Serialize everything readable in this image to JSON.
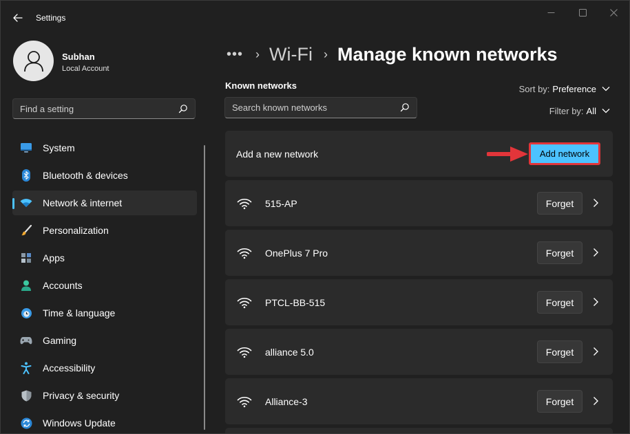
{
  "window": {
    "title": "Settings"
  },
  "user": {
    "name": "Subhan",
    "account_type": "Local Account"
  },
  "sidebar": {
    "search_placeholder": "Find a setting",
    "items": [
      {
        "label": "System",
        "icon": "monitor-icon",
        "active": false
      },
      {
        "label": "Bluetooth & devices",
        "icon": "bluetooth-icon",
        "active": false
      },
      {
        "label": "Network & internet",
        "icon": "wifi-icon",
        "active": true
      },
      {
        "label": "Personalization",
        "icon": "brush-icon",
        "active": false
      },
      {
        "label": "Apps",
        "icon": "apps-icon",
        "active": false
      },
      {
        "label": "Accounts",
        "icon": "person-icon",
        "active": false
      },
      {
        "label": "Time & language",
        "icon": "globe-clock-icon",
        "active": false
      },
      {
        "label": "Gaming",
        "icon": "gamepad-icon",
        "active": false
      },
      {
        "label": "Accessibility",
        "icon": "accessibility-icon",
        "active": false
      },
      {
        "label": "Privacy & security",
        "icon": "shield-icon",
        "active": false
      },
      {
        "label": "Windows Update",
        "icon": "sync-icon",
        "active": false
      }
    ]
  },
  "breadcrumb": {
    "dots": "•••",
    "parent": "Wi-Fi",
    "current": "Manage known networks"
  },
  "known_networks": {
    "title": "Known networks",
    "search_placeholder": "Search known networks",
    "sort": {
      "label": "Sort by:",
      "value": "Preference"
    },
    "filter": {
      "label": "Filter by:",
      "value": "All"
    },
    "add": {
      "label": "Add a new network",
      "button": "Add network"
    },
    "forget_label": "Forget",
    "networks": [
      {
        "name": "515-AP"
      },
      {
        "name": "OnePlus 7 Pro"
      },
      {
        "name": "PTCL-BB-515"
      },
      {
        "name": "alliance 5.0"
      },
      {
        "name": "Alliance-3"
      }
    ]
  },
  "colors": {
    "accent": "#4cc2ff",
    "highlight": "#e2353a",
    "background": "#202020",
    "card": "#2b2b2b"
  }
}
